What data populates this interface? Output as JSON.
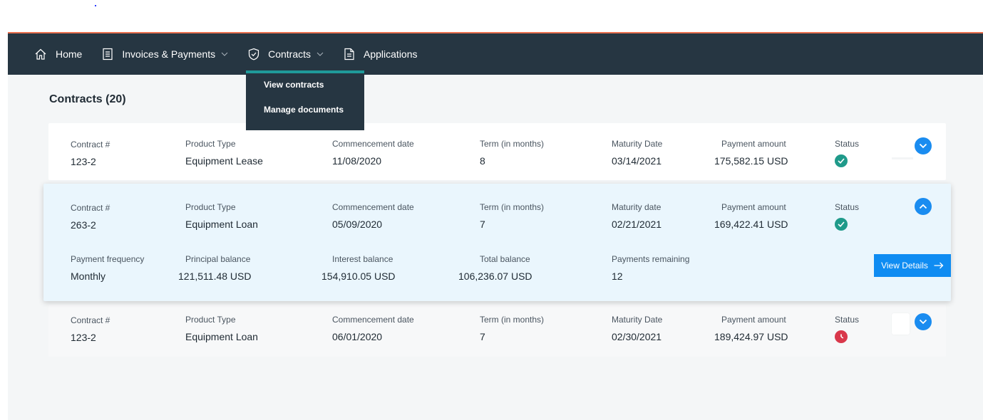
{
  "nav": {
    "home": "Home",
    "invoices": "Invoices & Payments",
    "contracts": "Contracts",
    "applications": "Applications"
  },
  "dropdown": {
    "items": [
      "View contracts",
      "Manage documents"
    ]
  },
  "page": {
    "title": "Contracts (20)"
  },
  "contracts": [
    {
      "labels": [
        "Contract #",
        "Product Type",
        "Commencement date",
        "Term (in months)",
        "Maturity Date",
        "Payment amount",
        "Status"
      ],
      "values": [
        "123-2",
        "Equipment Lease",
        "11/08/2020",
        "8",
        "03/14/2021",
        "175,582.15 USD"
      ],
      "status": "active"
    },
    {
      "labels": [
        "Contract #",
        "Product Type",
        "Commencement date",
        "Term (in months)",
        "Maturity date",
        "Payment amount",
        "Status"
      ],
      "values": [
        "263-2",
        "Equipment Loan",
        "05/09/2020",
        "7",
        "02/21/2021",
        "169,422.41 USD"
      ],
      "status": "active",
      "details": {
        "labels": [
          "Payment frequency",
          "Principal balance",
          "Interest balance",
          "Total balance",
          "Payments remaining"
        ],
        "values": [
          "Monthly",
          "121,511.48 USD",
          "154,910.05 USD",
          "106,236.07 USD",
          "12"
        ]
      },
      "view_details": "View Details"
    },
    {
      "labels": [
        "Contract #",
        "Product Type",
        "Commencement date",
        "Term (in months)",
        "Maturity Date",
        "Payment amount",
        "Status"
      ],
      "values": [
        "123-2",
        "Equipment Loan",
        "06/01/2020",
        "7",
        "02/30/2021",
        "189,424.97 USD"
      ],
      "status": "overdue"
    }
  ],
  "colors": {
    "navbar": "#263642",
    "accent_teal": "#1f9a9a",
    "primary_blue": "#0f8cf2",
    "status_ok": "#1f9a8a",
    "status_overdue": "#d9384b",
    "expanded_bg": "#eaf6fd"
  }
}
